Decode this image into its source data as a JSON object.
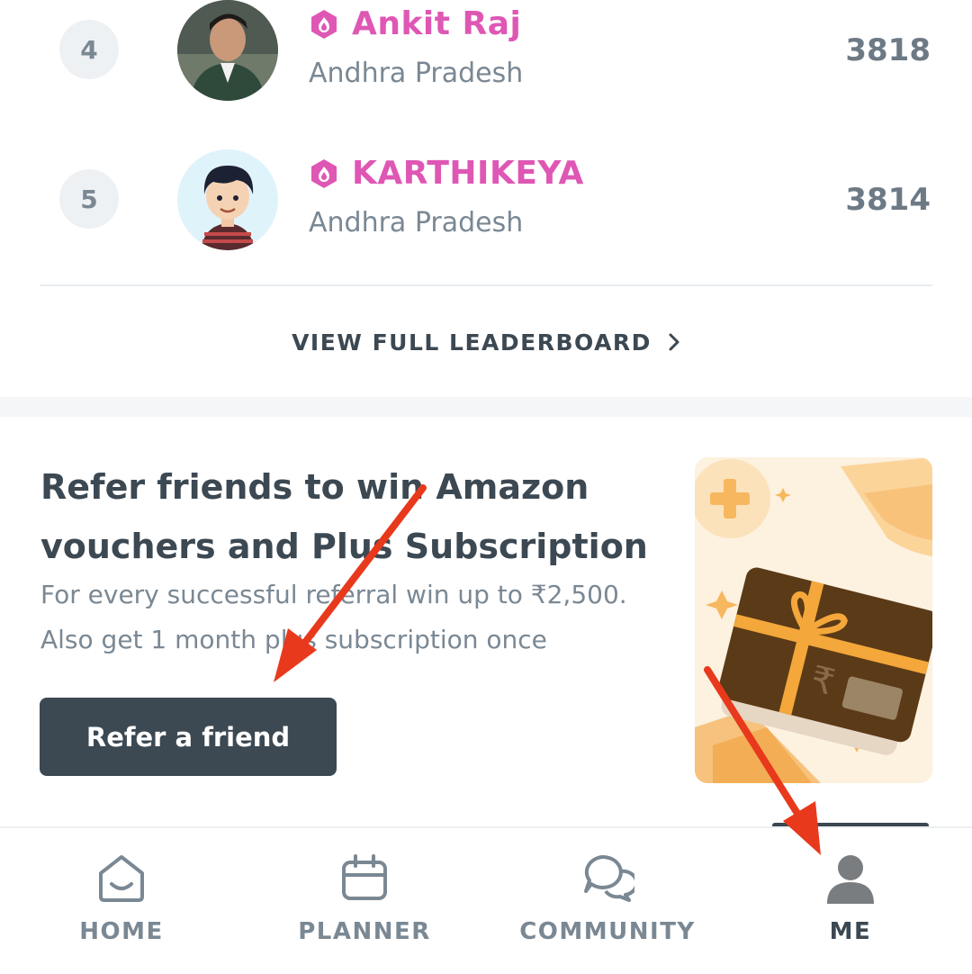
{
  "leaderboard": {
    "rows": [
      {
        "rank": "4",
        "name": "Ankit Raj",
        "state": "Andhra Pradesh",
        "score": "3818"
      },
      {
        "rank": "5",
        "name": "KARTHIKEYA",
        "state": "Andhra Pradesh",
        "score": "3814"
      }
    ],
    "view_full_label": "VIEW FULL LEADERBOARD"
  },
  "referral": {
    "title_line1": "Refer friends to win Amazon",
    "title_line2": "vouchers and Plus Subscription",
    "subtitle_line1": "For every successful referral win up to ₹2,500.",
    "subtitle_line2": "Also get 1 month plus subscription once",
    "button_label": "Refer a friend"
  },
  "bottom_nav": {
    "items": [
      {
        "label": "HOME",
        "icon": "home-icon",
        "active": false
      },
      {
        "label": "PLANNER",
        "icon": "calendar-icon",
        "active": false
      },
      {
        "label": "COMMUNITY",
        "icon": "chat-bubbles-icon",
        "active": false
      },
      {
        "label": "ME",
        "icon": "profile-icon",
        "active": true
      }
    ]
  },
  "colors": {
    "accent_pink": "#df57b4",
    "dark": "#3c4852",
    "muted": "#7a8894",
    "annotation_arrow": "#e8391c"
  }
}
